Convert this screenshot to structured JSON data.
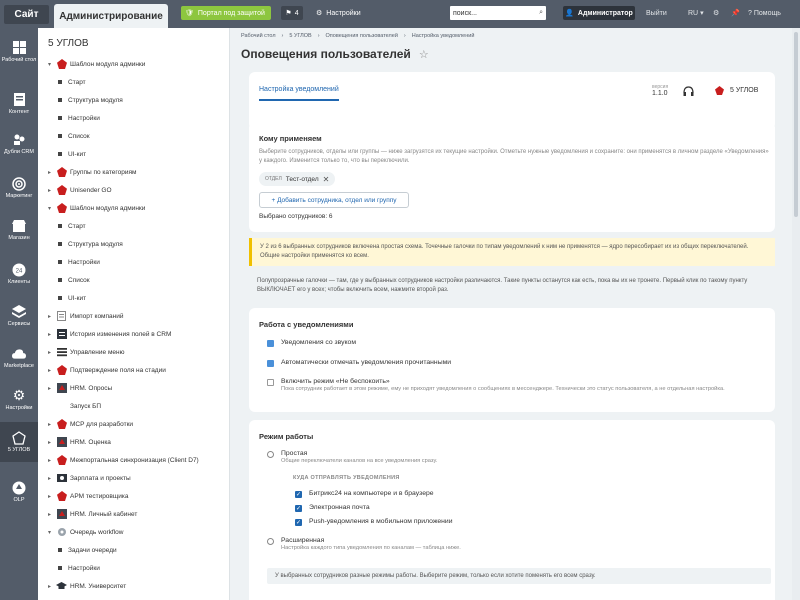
{
  "topbar": {
    "site_tab": "Сайт",
    "admin_tab": "Администрирование",
    "portal_label": "Портал под защитой",
    "notif_count": "4",
    "settings_label": "Настройки",
    "search_placeholder": "поиск...",
    "user_label": "Администратор",
    "logout_label": "Выйти",
    "lang_label": "RU",
    "help_label": "Помощь"
  },
  "leftbar": {
    "items": [
      {
        "label": "Рабочий стол",
        "icon": "desktop-icon"
      },
      {
        "label": "Контент",
        "icon": "content-icon"
      },
      {
        "label": "Дубли CRM",
        "icon": "crm-duplicates-icon"
      },
      {
        "label": "Маркетинг",
        "icon": "marketing-icon"
      },
      {
        "label": "Магазин",
        "icon": "shop-icon"
      },
      {
        "label": "Клиенты",
        "icon": "clients-icon"
      },
      {
        "label": "Сервисы",
        "icon": "services-icon"
      },
      {
        "label": "Marketplace",
        "icon": "marketplace-icon"
      },
      {
        "label": "Настройки",
        "icon": "gear-icon"
      },
      {
        "label": "5 УГЛОВ",
        "icon": "5ugl-icon"
      },
      {
        "label": "OLP",
        "icon": "olp-icon"
      }
    ]
  },
  "tree": {
    "title": "5 УГЛОВ",
    "items": [
      "Шаблон модуля админки",
      "Старт",
      "Структура модуля",
      "Настройки",
      "Список",
      "UI-кит",
      "Группы по категориям",
      "Unisender GO",
      "Шаблон модуля админки",
      "Старт",
      "Структура модуля",
      "Настройки",
      "Список",
      "UI-кит",
      "Импорт компаний",
      "История изменения полей в CRM",
      "Управление меню",
      "Подтверждение поля на стадии",
      "HRM. Опросы",
      "Запуск БП",
      "MCP для разработки",
      "HRM. Оценка",
      "Межпортальная синхронизация (Client D7)",
      "Зарплата и проекты",
      "АРМ тестировщика",
      "HRM. Личный кабинет",
      "Очередь workflow",
      "Задачи очереди",
      "Настройки",
      "HRM. Университет"
    ]
  },
  "main": {
    "breadcrumbs": [
      "Рабочий стол",
      "5 УГЛОВ",
      "Оповещения пользователей",
      "Настройка уведомлений"
    ],
    "title": "Оповещения пользователей",
    "header": {
      "tab": "Настройка уведомлений",
      "version_label": "версия",
      "version": "1.1.0",
      "brand": "5 УГЛОВ"
    },
    "apply": {
      "title": "Кому применяем",
      "desc": "Выберите сотрудников, отделы или группы — ниже загрузятся их текущие настройки. Отметьте нужные уведомления и сохраните: они применятся в личном разделе «Уведомления» у каждого. Изменится только то, что вы переключили.",
      "chip_label": "ОТДЕЛ",
      "chip_value": "Тест-отдел",
      "add_button": "+ Добавить сотрудника, отдел или группу",
      "selected": "Выбрано сотрудников: 6"
    },
    "warning": "У 2 из 6 выбранных сотрудников включена простая схема. Точечные галочки по типам уведомлений к ним не применятся — ядро пересобирает их из общих переключателей. Общие настройки применятся ко всем.",
    "info": "Полупрозрачные галочки — там, где у выбранных сотрудников настройки различаются. Такие пункты останутся как есть, пока вы их не тронете. Первый клик по такому пункту ВЫКЛЮЧАЕТ его у всех; чтобы включить всем, нажмите второй раз.",
    "work": {
      "title": "Работа с уведомлениями",
      "opt1": "Уведомления со звуком",
      "opt2": "Автоматически отмечать уведомления прочитанными",
      "opt3": "Включить режим «Не беспокоить»",
      "opt3_desc": "Пока сотрудник работает в этом режиме, ему не приходят уведомления о сообщениях в мессенджере. Технически это статус пользователя, а не отдельная настройка."
    },
    "mode": {
      "title": "Режим работы",
      "simple": "Простая",
      "simple_desc": "Общие переключатели каналов на все уведомления сразу.",
      "where_label": "КУДА ОТПРАВЛЯТЬ УВЕДОМЛЕНИЯ",
      "ch1": "Битрикс24 на компьютере и в браузере",
      "ch2": "Электронная почта",
      "ch3": "Push-уведомления в мобильном приложении",
      "extended": "Расширенная",
      "extended_desc": "Настройка каждого типа уведомления по каналам — таблица ниже.",
      "note": "У выбранных сотрудников разные режимы работы. Выберите режим, только если хотите поменять его всем сразу."
    }
  }
}
